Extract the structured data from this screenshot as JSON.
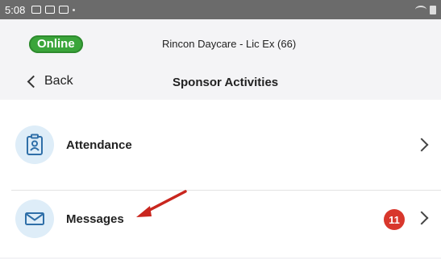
{
  "status_bar": {
    "time": "5:08"
  },
  "header": {
    "status_badge": "Online",
    "provider": "Rincon Daycare - Lic Ex (66)",
    "back_label": "Back",
    "title": "Sponsor Activities"
  },
  "list": {
    "items": [
      {
        "label": "Attendance",
        "icon": "id-badge-icon"
      },
      {
        "label": "Messages",
        "icon": "envelope-icon",
        "badge": "11"
      }
    ]
  },
  "colors": {
    "online": "#3aa53a",
    "badge": "#d8372c",
    "icon_bg": "#deedf8",
    "annotation_arrow": "#c9261e"
  }
}
